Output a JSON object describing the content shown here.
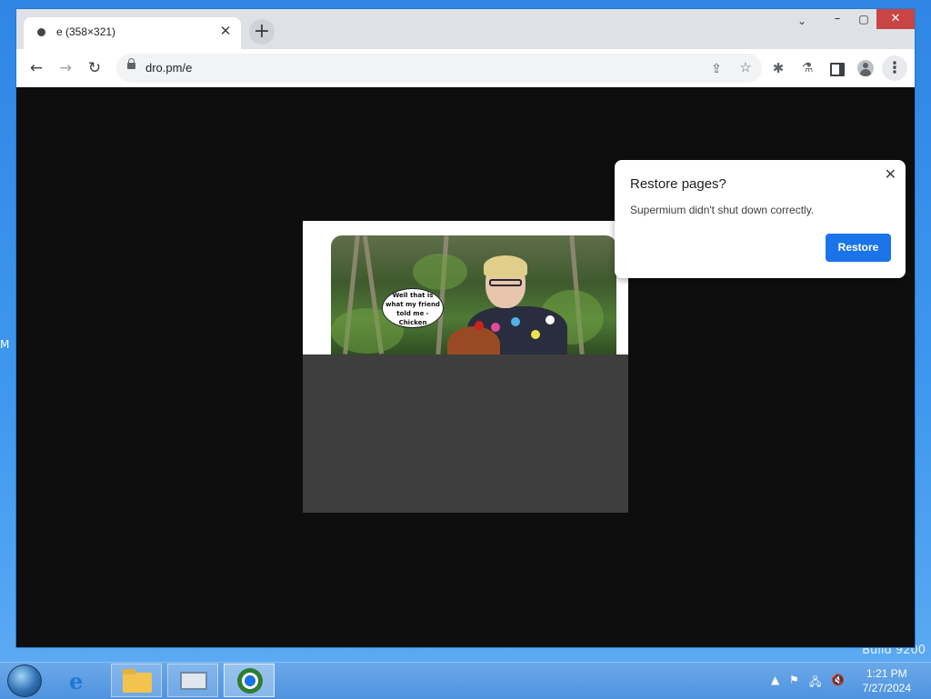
{
  "desktop": {
    "edge_letter": "M",
    "build_watermark": "Build 9200"
  },
  "browser": {
    "tab": {
      "title": "e (358×321)",
      "close_glyph": "✕"
    },
    "new_tab_glyph": "+",
    "window_controls": {
      "tab_search": "⌄",
      "minimize": "–",
      "maximize": "▢",
      "close": "✕"
    },
    "toolbar": {
      "back": "←",
      "forward": "→",
      "reload": "↻",
      "url": "dro.pm/e",
      "share": "⇪",
      "star": "☆",
      "extensions": "✱",
      "labs": "⚗",
      "menu": "⋮"
    },
    "page": {
      "image_caption": "Well that is what my friend told me - Chicken"
    },
    "restore_popup": {
      "title": "Restore pages?",
      "body": "Supermium didn't shut down correctly.",
      "button": "Restore",
      "close": "✕"
    }
  },
  "taskbar": {
    "clock_time": "1:21 PM",
    "clock_date": "7/27/2024",
    "tray_arrow": "▲",
    "flag": "⚑",
    "network": "🖧",
    "volume": "🔇"
  },
  "colors": {
    "accent": "#1a73e8",
    "window_close": "#c94444",
    "desktop": "#3f98ee"
  }
}
